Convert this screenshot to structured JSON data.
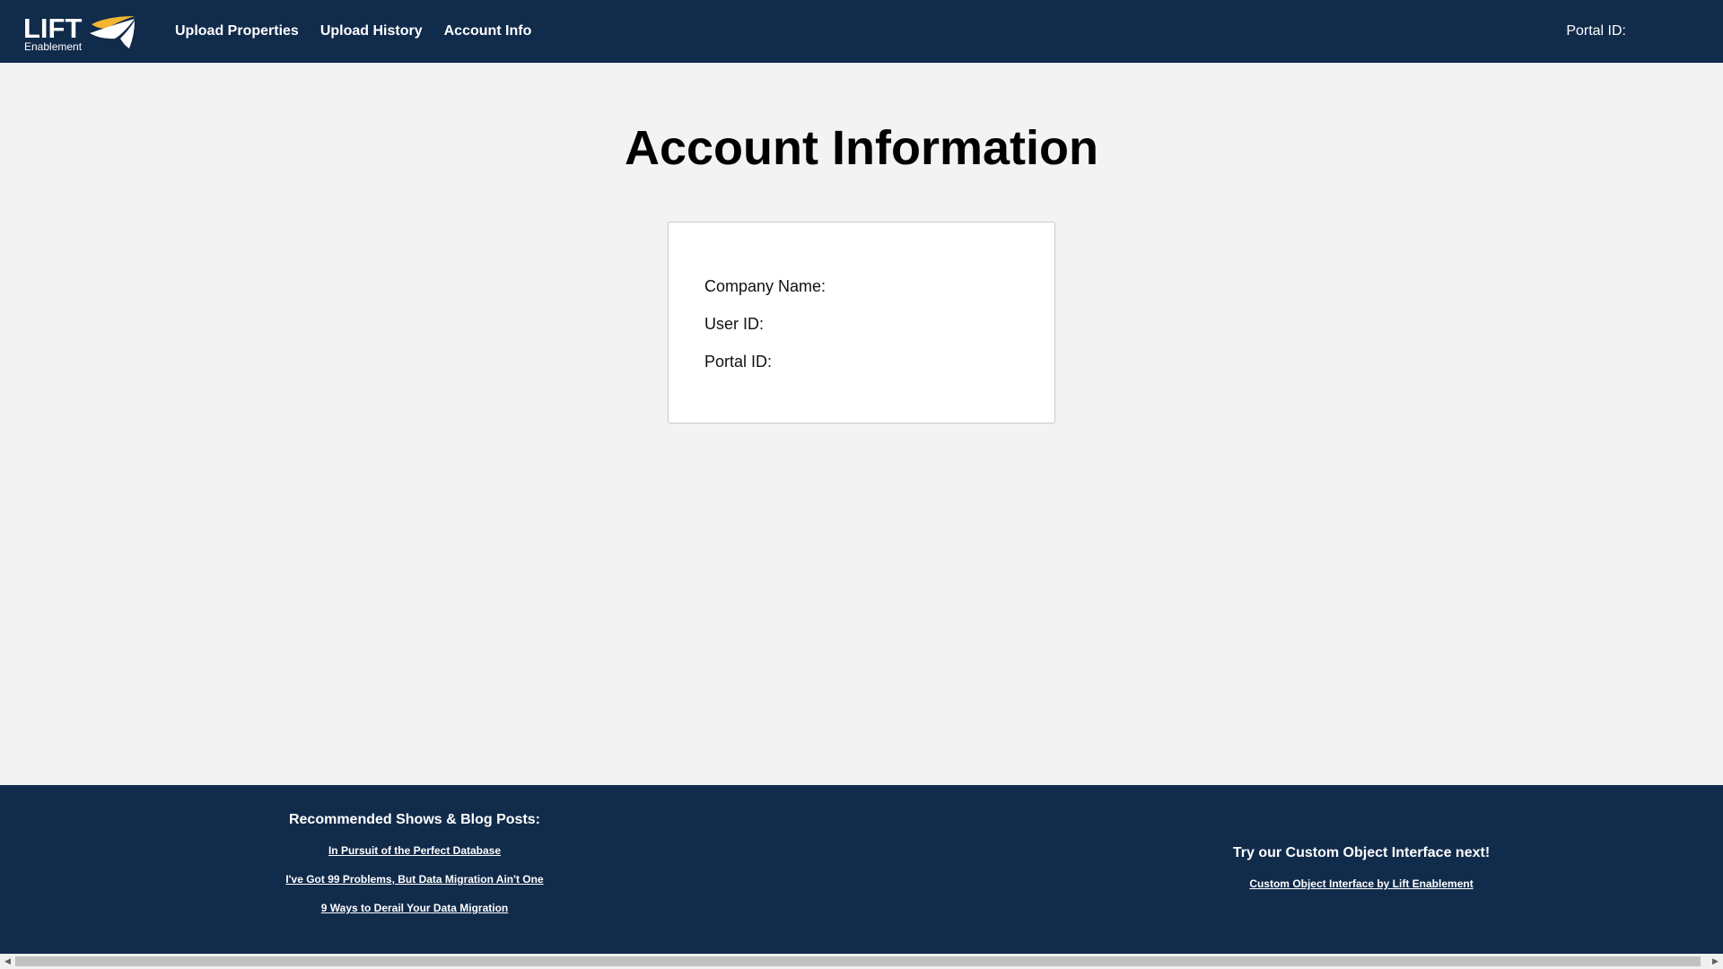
{
  "colors": {
    "navbar_bg": "#112b4b",
    "page_bg": "#f3f3f3",
    "logo_accent": "#f2b632"
  },
  "logo": {
    "main_text": "LIFT",
    "sub_text": "Enablement"
  },
  "nav": {
    "items": [
      {
        "label": "Upload Properties"
      },
      {
        "label": "Upload History"
      },
      {
        "label": "Account Info"
      }
    ],
    "portal_label": "Portal ID:"
  },
  "main": {
    "title": "Account Information",
    "card": {
      "company_name_label": "Company Name:",
      "user_id_label": "User ID:",
      "portal_id_label": "Portal ID:"
    }
  },
  "footer": {
    "left": {
      "heading": "Recommended Shows & Blog Posts:",
      "links": [
        {
          "label": "In Pursuit of the Perfect Database"
        },
        {
          "label": "I've Got 99 Problems, But Data Migration Ain't One"
        },
        {
          "label": "9 Ways to Derail Your Data Migration"
        }
      ]
    },
    "right": {
      "heading": "Try our Custom Object Interface next!",
      "link": "Custom Object Interface by Lift Enablement"
    }
  },
  "scrollbar": {
    "left_arrow_icon": "arrow-left-icon",
    "right_arrow_icon": "arrow-right-icon"
  }
}
